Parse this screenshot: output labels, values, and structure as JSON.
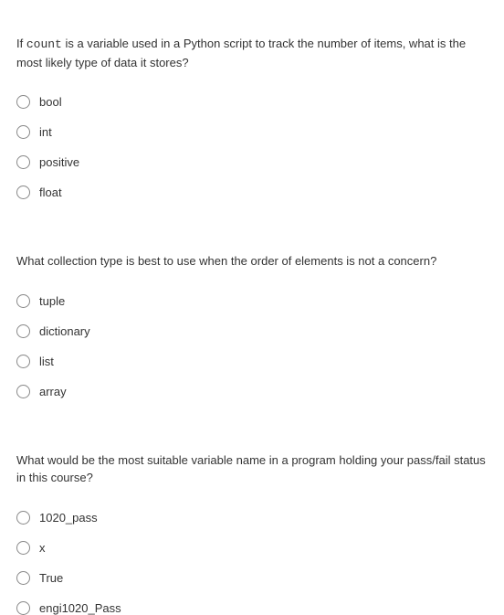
{
  "questions": [
    {
      "prompt_prefix": "If ",
      "prompt_code": "count",
      "prompt_suffix": " is a variable used in a Python script to track the number of items, what is the most likely type of data it stores?",
      "options": [
        "bool",
        "int",
        "positive",
        "float"
      ]
    },
    {
      "prompt_prefix": "What collection type is best to use when the order of elements is not a concern?",
      "prompt_code": "",
      "prompt_suffix": "",
      "options": [
        "tuple",
        "dictionary",
        "list",
        "array"
      ]
    },
    {
      "prompt_prefix": "What would be the most suitable variable name in a program holding your pass/fail status in this course?",
      "prompt_code": "",
      "prompt_suffix": "",
      "options": [
        "1020_pass",
        "x",
        "True",
        "engi1020_Pass"
      ]
    }
  ]
}
